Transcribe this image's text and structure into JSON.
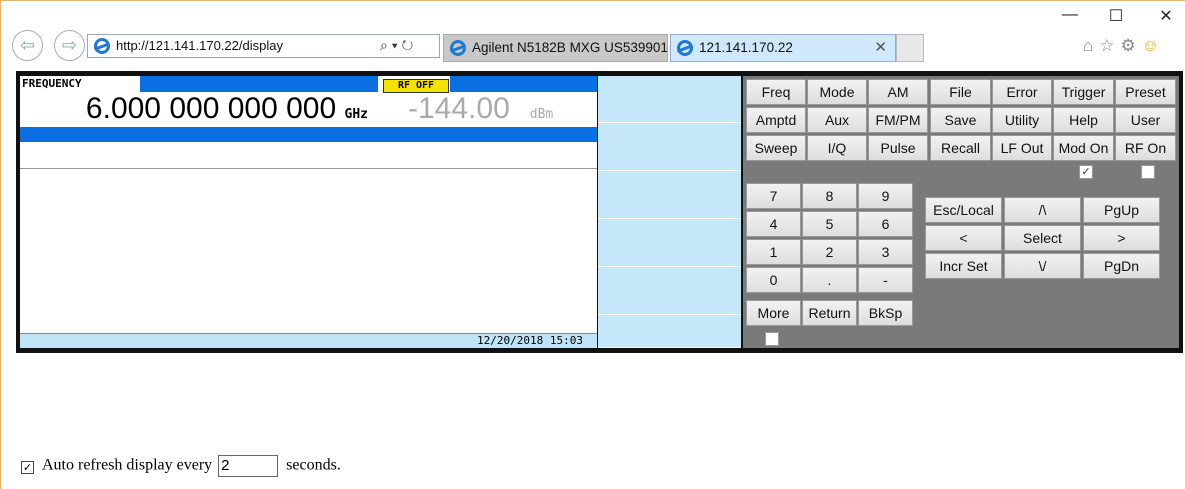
{
  "browser": {
    "url": "http://121.141.170.22/display",
    "tabs": [
      {
        "label": "Agilent N5182B MXG US539901..."
      },
      {
        "label": "121.141.170.22"
      }
    ],
    "window_controls": {
      "minimize": "—",
      "maximize": "☐",
      "close": "✕"
    },
    "addr_tools": "⌕ ▾ ↻"
  },
  "display": {
    "frequency_label": "FREQUENCY",
    "frequency_value": "6.000 000 000 000",
    "frequency_unit": "GHz",
    "rf_status": "RF OFF",
    "amplitude_value": "-144.00",
    "amplitude_unit": "dBm",
    "timestamp": "12/20/2018 15:03"
  },
  "keys": {
    "top": [
      "Freq",
      "Mode",
      "AM",
      "File",
      "Error",
      "Trigger",
      "Preset",
      "Amptd",
      "Aux",
      "FM/PM",
      "Save",
      "Utility",
      "Help",
      "User",
      "Sweep",
      "I/Q",
      "Pulse",
      "Recall",
      "LF Out",
      "Mod On",
      "RF On"
    ],
    "numpad": [
      "7",
      "8",
      "9",
      "4",
      "5",
      "6",
      "1",
      "2",
      "3",
      "0",
      ".",
      "-"
    ],
    "bottom": [
      "More",
      "Return",
      "BkSp"
    ],
    "nav": [
      "Esc/Local",
      "/\\",
      "PgUp",
      "<",
      "Select",
      ">",
      "Incr Set",
      "\\/",
      "PgDn"
    ]
  },
  "footer": {
    "label_before": "Auto refresh display every",
    "refresh_value": "2",
    "label_after": "seconds."
  }
}
